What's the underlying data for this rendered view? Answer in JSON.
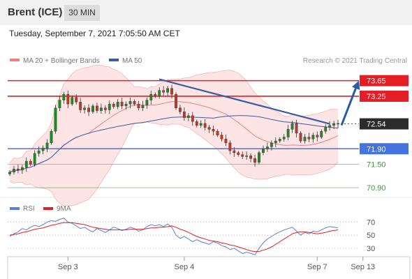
{
  "header": {
    "instrument": "Brent (ICE)",
    "timeframe": "30 MIN"
  },
  "datetime": "Tuesday, September 7, 2021 7:05:50 AM CET",
  "legend": {
    "items": [
      {
        "label": "MA 20 + Bollinger Bands",
        "color": "#f08080"
      },
      {
        "label": "MA 50",
        "color": "#3b5ba5"
      }
    ],
    "credit": "Research © 2021 Trading Central"
  },
  "rsi_legend": {
    "items": [
      {
        "label": "RSI",
        "color": "#5b7fd6"
      },
      {
        "label": "9MA",
        "color": "#e31e24"
      }
    ]
  },
  "colors": {
    "resistance": "#e31e24",
    "pivot": "#4472e0",
    "support": "#3a9a3a",
    "current": "#2b2b2b",
    "candle_up": "#1f8a2a",
    "candle_down": "#c0392b",
    "bollinger_fill": "#fde0e0",
    "ma20": "#f08080",
    "ma50": "#3b5ba5",
    "trendline": "#3b5ba5",
    "arrow": "#2a5ba8"
  },
  "chart_data": {
    "type": "candlestick",
    "ylim": [
      70.65,
      73.93
    ],
    "price_levels": [
      {
        "value": 73.65,
        "label": "73.65",
        "kind": "resistance"
      },
      {
        "value": 73.25,
        "label": "73.25",
        "kind": "resistance"
      },
      {
        "value": 72.54,
        "label": "72.54",
        "kind": "current"
      },
      {
        "value": 71.9,
        "label": "71.90",
        "kind": "pivot"
      },
      {
        "value": 71.5,
        "label": "71.50",
        "kind": "support"
      },
      {
        "value": 70.9,
        "label": "70.90",
        "kind": "support"
      }
    ],
    "x_ticks": [
      {
        "index": 14,
        "label": "Sep 3"
      },
      {
        "index": 42,
        "label": "Sep 4"
      },
      {
        "index": 74,
        "label": "Sep 7"
      },
      {
        "index": 85,
        "label": "Sep 13"
      }
    ],
    "closes": [
      71.3,
      71.38,
      71.35,
      71.42,
      71.58,
      71.5,
      71.78,
      71.85,
      71.92,
      72.05,
      72.35,
      72.95,
      73.15,
      73.3,
      73.05,
      73.22,
      73.1,
      72.9,
      72.95,
      72.85,
      73.0,
      72.88,
      72.95,
      72.9,
      73.05,
      72.98,
      73.1,
      73.0,
      73.05,
      73.12,
      73.05,
      72.95,
      73.02,
      73.15,
      73.3,
      73.25,
      73.4,
      73.35,
      73.45,
      73.3,
      72.95,
      72.85,
      72.7,
      72.75,
      72.6,
      72.5,
      72.55,
      72.45,
      72.4,
      72.35,
      72.25,
      72.15,
      72.05,
      71.85,
      71.8,
      71.75,
      71.7,
      71.72,
      71.65,
      71.55,
      71.8,
      71.9,
      71.95,
      72.05,
      72.1,
      72.15,
      72.2,
      72.4,
      72.55,
      72.3,
      72.1,
      72.2,
      72.15,
      72.25,
      72.2,
      72.35,
      72.45,
      72.5,
      72.55,
      72.54
    ],
    "rsi": {
      "ticks": [
        70,
        50,
        30
      ],
      "ylim": [
        15,
        82
      ],
      "rsi": [
        48,
        52,
        55,
        60,
        58,
        62,
        65,
        63,
        66,
        70,
        72,
        71,
        74,
        76,
        70,
        68,
        64,
        60,
        62,
        58,
        55,
        60,
        57,
        54,
        58,
        62,
        60,
        57,
        59,
        62,
        60,
        56,
        58,
        63,
        66,
        64,
        66,
        63,
        67,
        62,
        50,
        45,
        48,
        44,
        40,
        43,
        40,
        38,
        36,
        40,
        38,
        34,
        32,
        28,
        30,
        26,
        22,
        24,
        22,
        20,
        30,
        38,
        44,
        48,
        52,
        55,
        58,
        60,
        62,
        56,
        50,
        54,
        52,
        56,
        55,
        58,
        61,
        63,
        62,
        61
      ],
      "ma9": [
        50,
        51,
        52,
        54,
        55,
        57,
        59,
        60,
        61,
        63,
        65,
        66,
        68,
        69,
        69,
        69,
        68,
        67,
        66,
        64,
        62,
        61,
        60,
        59,
        58,
        58,
        58,
        58,
        58,
        59,
        59,
        59,
        59,
        60,
        61,
        61,
        62,
        62,
        63,
        64,
        62,
        59,
        57,
        54,
        51,
        48,
        46,
        44,
        42,
        41,
        40,
        38,
        37,
        35,
        34,
        32,
        30,
        28,
        26,
        25,
        25,
        27,
        29,
        32,
        36,
        40,
        44,
        48,
        52,
        54,
        55,
        55,
        54,
        53,
        52,
        53,
        54,
        56,
        57,
        58
      ]
    }
  }
}
